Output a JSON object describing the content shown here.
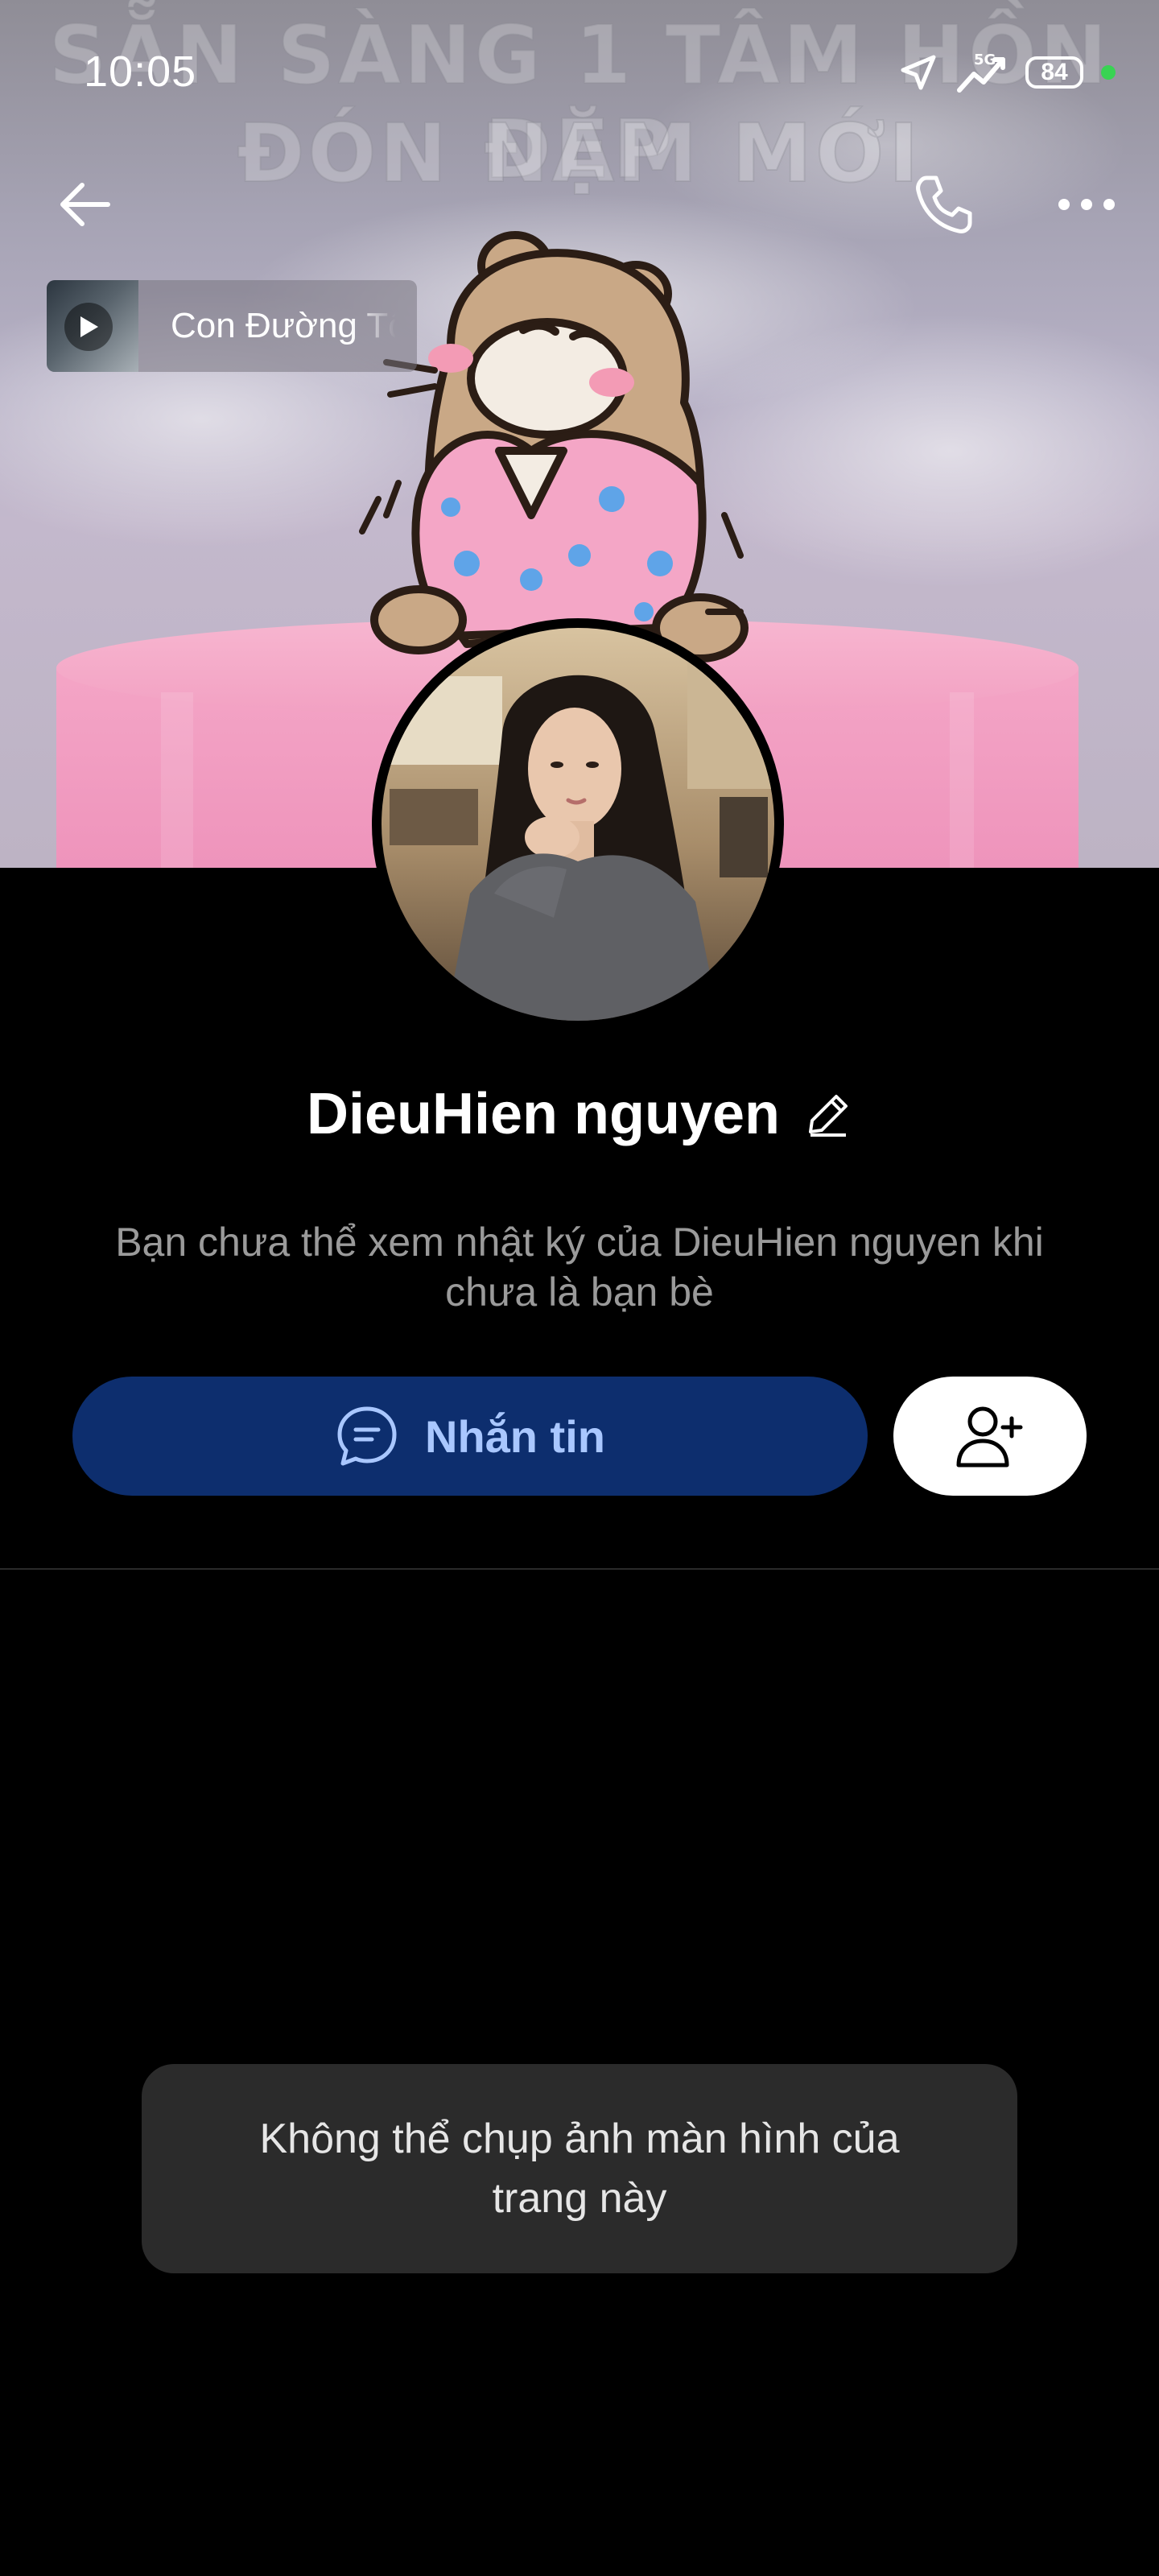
{
  "status_bar": {
    "time": "10:05",
    "network": "5G",
    "battery": "84",
    "icons": [
      "navigation-icon",
      "signal-5g-icon",
      "battery-icon",
      "active-dot-icon"
    ]
  },
  "cover": {
    "text_line_1": "SẴN SÀNG 1 TÂM HỒN ĐẸP",
    "text_line_2": "ĐÓN NĂM MỚI"
  },
  "nav": {
    "icons": [
      "back-arrow-icon",
      "phone-icon",
      "more-icon"
    ]
  },
  "music": {
    "title": "Con Đường Tôi"
  },
  "profile": {
    "name": "DieuHien nguyen",
    "diary_notice": "Bạn chưa thể xem nhật ký của DieuHien nguyen khi chưa là bạn bè"
  },
  "actions": {
    "message_label": "Nhắn tin",
    "message_icon": "chat-bubble-icon",
    "add_friend_icon": "add-friend-icon"
  },
  "toast": {
    "text": "Không thể chụp ảnh màn hình của trang này"
  },
  "colors": {
    "message_button_bg": "#0d2e6e",
    "message_button_text": "#a9c7ff",
    "background": "#000000",
    "toast_bg": "#2b2b2b",
    "status_dot": "#39d353"
  }
}
